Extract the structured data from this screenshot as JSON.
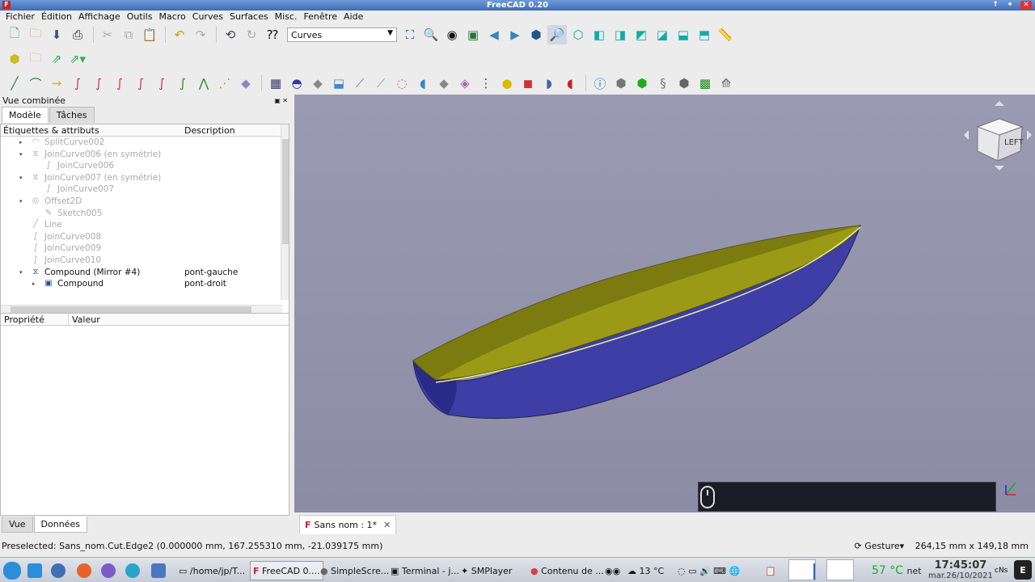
{
  "window": {
    "title": "FreeCAD 0.20",
    "app_icon": "freecad-icon"
  },
  "menu": [
    "Fichier",
    "Édition",
    "Affichage",
    "Outils",
    "Macro",
    "Curves",
    "Surfaces",
    "Misc.",
    "Fenêtre",
    "Aide"
  ],
  "toolbar": {
    "workbench": "Curves"
  },
  "combo": {
    "title": "Vue combinée",
    "tabs": [
      "Modèle",
      "Tâches"
    ],
    "tree_headers": [
      "Étiquettes & attributs",
      "Description"
    ],
    "tree": [
      {
        "label": "SplitCurve002",
        "desc": "",
        "level": 0,
        "expand": "▸",
        "icon": "◠",
        "dim": true
      },
      {
        "label": "JoinCurve006 (en symétrie)",
        "desc": "",
        "level": 0,
        "expand": "▾",
        "icon": "⧖",
        "dim": true
      },
      {
        "label": "JoinCurve006",
        "desc": "",
        "level": 1,
        "expand": "",
        "icon": "∫",
        "dim": true
      },
      {
        "label": "JoinCurve007 (en symétrie)",
        "desc": "",
        "level": 0,
        "expand": "▾",
        "icon": "⧖",
        "dim": true
      },
      {
        "label": "JoinCurve007",
        "desc": "",
        "level": 1,
        "expand": "",
        "icon": "∫",
        "dim": true
      },
      {
        "label": "Offset2D",
        "desc": "",
        "level": 0,
        "expand": "▾",
        "icon": "◎",
        "dim": true
      },
      {
        "label": "Sketch005",
        "desc": "",
        "level": 1,
        "expand": "",
        "icon": "✎",
        "dim": true
      },
      {
        "label": "Line",
        "desc": "",
        "level": 0,
        "expand": "",
        "icon": "╱",
        "dim": true
      },
      {
        "label": "JoinCurve008",
        "desc": "",
        "level": 0,
        "expand": "",
        "icon": "∫",
        "dim": true
      },
      {
        "label": "JoinCurve009",
        "desc": "",
        "level": 0,
        "expand": "",
        "icon": "∫",
        "dim": true
      },
      {
        "label": "JoinCurve010",
        "desc": "",
        "level": 0,
        "expand": "",
        "icon": "∫",
        "dim": true
      },
      {
        "label": "Compound (Mirror #4)",
        "desc": "pont-gauche",
        "level": 0,
        "expand": "▾",
        "icon": "⧖",
        "dim": false
      },
      {
        "label": "Compound",
        "desc": "pont-droit",
        "level": 1,
        "expand": "▸",
        "icon": "▣",
        "dim": false
      }
    ],
    "props_headers": [
      "Propriété",
      "Valeur"
    ],
    "bottom_tabs": [
      "Vue",
      "Données"
    ]
  },
  "viewport": {
    "navcube_label": "LEFT",
    "hull_top_color": "#9a9a16",
    "hull_side_color": "#3e3ea6",
    "background": "#9494ac"
  },
  "document_tab": {
    "label": "Sans nom : 1*",
    "close": "✕"
  },
  "status": {
    "preselected": "Preselected: Sans_nom.Cut.Edge2 (0.000000 mm, 167.255310 mm, -21.039175 mm)",
    "nav_style": "Gesture",
    "dimensions": "264,15 mm x 149,18 mm"
  },
  "taskbar": {
    "items": [
      "/home/jp/T...",
      "FreeCAD 0....",
      "SimpleScre...",
      "Terminal - j...",
      "SMPlayer",
      "Contenu de ..."
    ],
    "weather": "13 °C",
    "cpu_temp": "57 °C",
    "net_label": "net",
    "clock_time": "17:45:07",
    "clock_date": "mar.26/10/2021",
    "keyboard": "cNs"
  }
}
